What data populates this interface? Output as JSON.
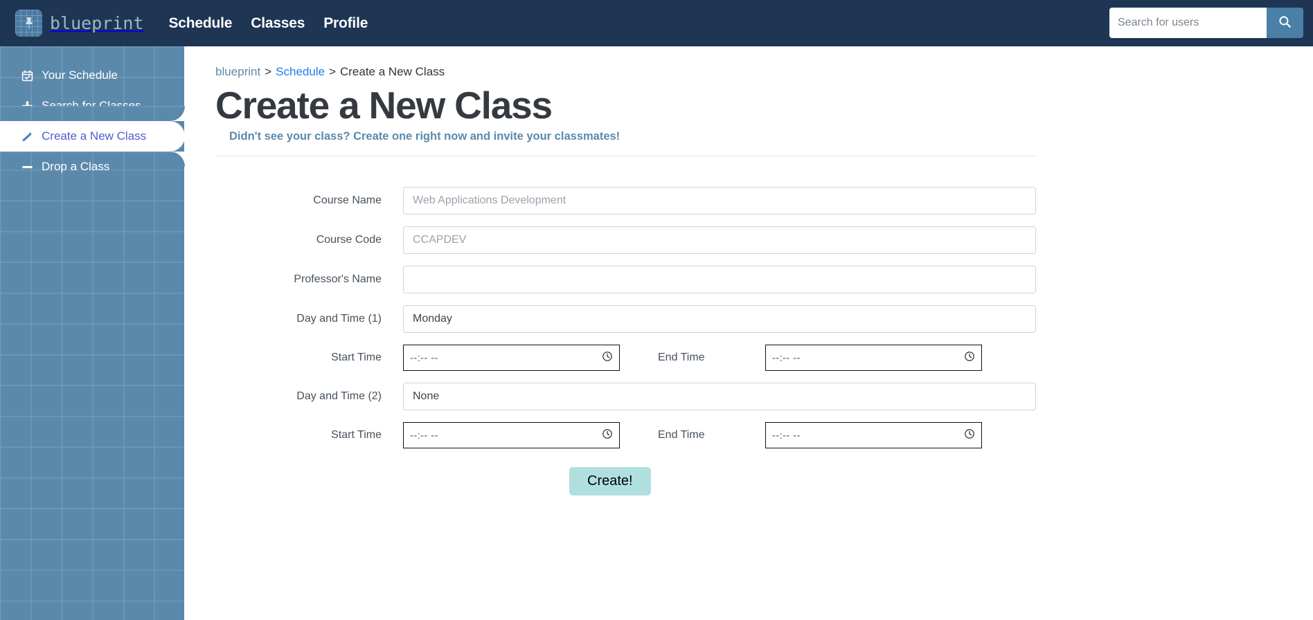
{
  "navbar": {
    "brand_name": "blueprint",
    "brand_icon": "pushpin-blueprint-logo",
    "links": [
      {
        "label": "Schedule"
      },
      {
        "label": "Classes"
      },
      {
        "label": "Profile"
      }
    ],
    "search": {
      "placeholder": "Search for users",
      "value": "",
      "button_icon": "search-icon"
    },
    "background_color": "#1e3553"
  },
  "sidebar": {
    "background_color": "#5b89ac",
    "active_text_color": "#4f5ecf",
    "items": [
      {
        "label": "Your Schedule",
        "icon": "calendar-check-icon",
        "active": false
      },
      {
        "label": "Search for Classes",
        "icon": "plus-icon",
        "active": false
      },
      {
        "label": "Create a New Class",
        "icon": "pencil-icon",
        "active": true
      },
      {
        "label": "Drop a Class",
        "icon": "minus-icon",
        "active": false
      }
    ]
  },
  "breadcrumb": {
    "home": "blueprint",
    "separator": ">",
    "link": "Schedule",
    "current": "Create a New Class"
  },
  "page": {
    "title": "Create a New Class",
    "subtitle": "Didn't see your class? Create one right now and invite your classmates!",
    "subtitle_color": "#5b89ac",
    "title_color": "#343a40"
  },
  "form": {
    "fields": [
      {
        "label": "Course Name",
        "value": "Web Applications Development",
        "is_placeholder": true
      },
      {
        "label": "Course Code",
        "value": "CCAPDEV",
        "is_placeholder": true
      },
      {
        "label": "Professor's Name",
        "value": "",
        "is_placeholder": true
      },
      {
        "label": "Day and Time (1)",
        "value": "Monday",
        "is_placeholder": false
      }
    ],
    "time_row_1": {
      "start_label": "Start Time",
      "start_value": "--:--  --",
      "end_label": "End Time",
      "end_value": "--:--  --",
      "clock_icon": "clock-icon"
    },
    "day_time_2": {
      "label": "Day and Time (2)",
      "value": "None",
      "is_placeholder": false
    },
    "time_row_2": {
      "start_label": "Start Time",
      "start_value": "--:--  --",
      "end_label": "End Time",
      "end_value": "--:--  --",
      "clock_icon": "clock-icon"
    },
    "submit_label": "Create!",
    "submit_color": "#b0dfdf"
  }
}
